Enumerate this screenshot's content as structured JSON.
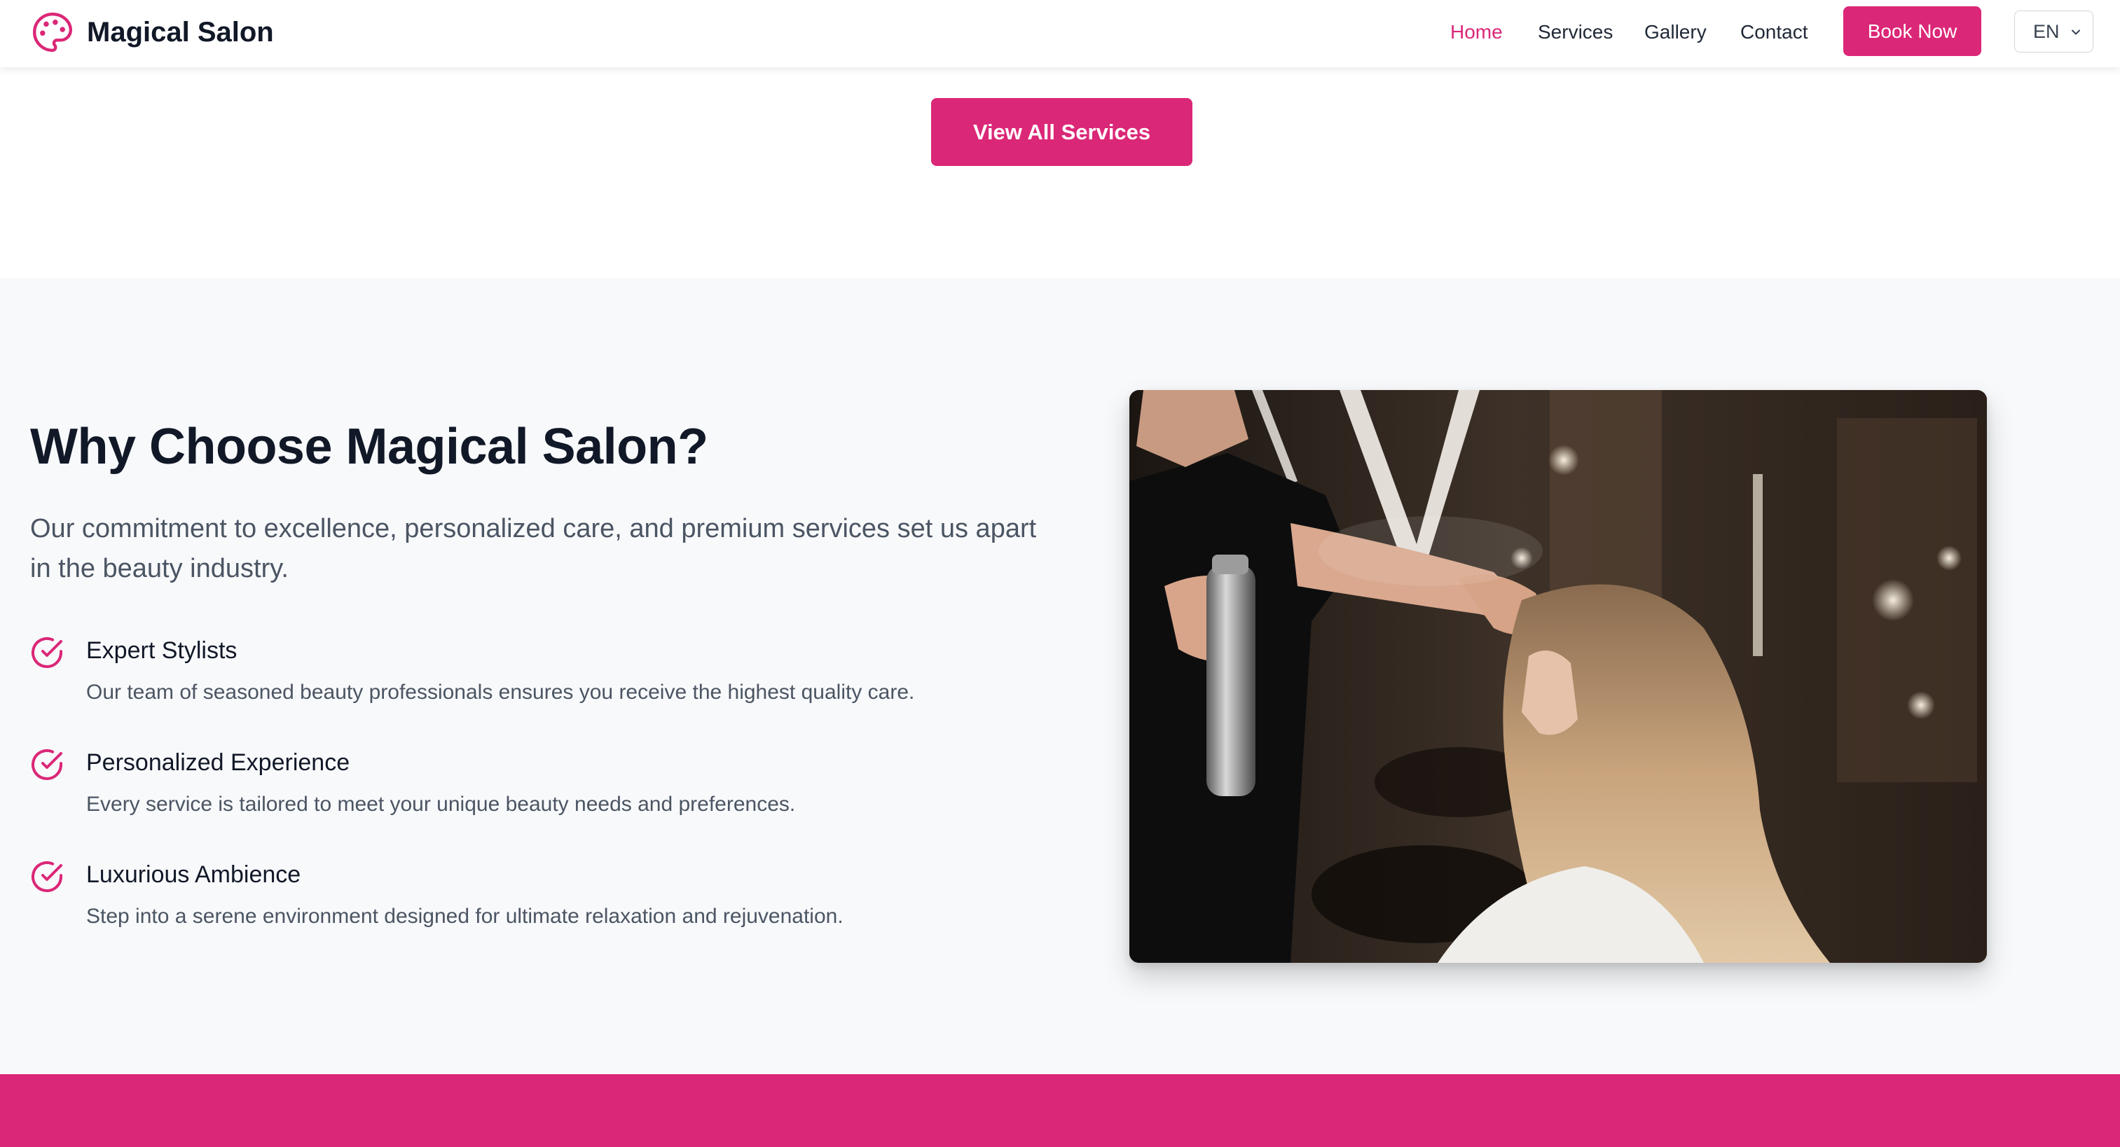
{
  "brand": {
    "name": "Magical Salon",
    "logo_icon": "palette-icon"
  },
  "nav": {
    "links": [
      {
        "label": "Home",
        "active": true
      },
      {
        "label": "Services",
        "active": false
      },
      {
        "label": "Gallery",
        "active": false
      },
      {
        "label": "Contact",
        "active": false
      }
    ],
    "book_label": "Book Now",
    "language": {
      "selected": "EN"
    }
  },
  "services": {
    "view_all_label": "View All Services"
  },
  "why": {
    "title": "Why Choose Magical Salon?",
    "subtitle": "Our commitment to excellence, personalized care, and premium services set us apart in the beauty industry.",
    "features": [
      {
        "icon": "check-circle-icon",
        "title": "Expert Stylists",
        "description": "Our team of seasoned beauty professionals ensures you receive the highest quality care."
      },
      {
        "icon": "check-circle-icon",
        "title": "Personalized Experience",
        "description": "Every service is tailored to meet your unique beauty needs and preferences."
      },
      {
        "icon": "check-circle-icon",
        "title": "Luxurious Ambience",
        "description": "Step into a serene environment designed for ultimate relaxation and rejuvenation."
      }
    ]
  },
  "colors": {
    "accent": "#db2777",
    "section_bg": "#f8f9fb",
    "heading": "#111827",
    "body_text": "#4b5563"
  }
}
